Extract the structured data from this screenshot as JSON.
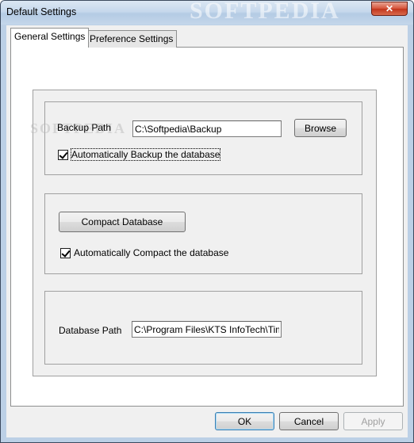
{
  "window": {
    "title": "Default Settings",
    "watermark": "SOFTPEDIA",
    "close_label": "✕"
  },
  "tabs": [
    {
      "label": "General Settings",
      "selected": true
    },
    {
      "label": "Preference Settings",
      "selected": false
    }
  ],
  "backup": {
    "path_label": "Backup Path",
    "path_value": "C:\\Softpedia\\Backup",
    "browse_label": "Browse",
    "auto_label": "Automatically Backup the database",
    "auto_checked": true
  },
  "compact": {
    "button_label": "Compact Database",
    "auto_label": "Automatically Compact the database",
    "auto_checked": true
  },
  "database": {
    "path_label": "Database Path",
    "path_value": "C:\\Program Files\\KTS InfoTech\\TimeT"
  },
  "footer": {
    "ok_label": "OK",
    "cancel_label": "Cancel",
    "apply_label": "Apply"
  }
}
